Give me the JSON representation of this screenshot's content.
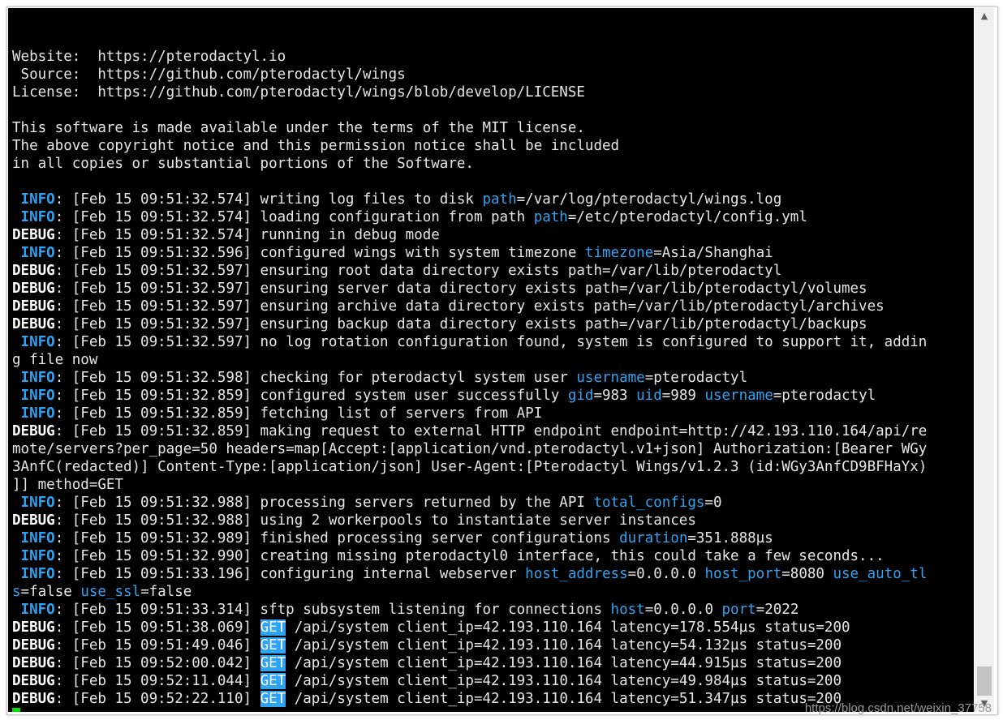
{
  "terminal": {
    "lines": [
      {
        "segments": []
      },
      {
        "segments": [
          {
            "text": "Website:  https://pterodactyl.io",
            "cls": ""
          }
        ]
      },
      {
        "segments": [
          {
            "text": " Source:  https://github.com/pterodactyl/wings",
            "cls": ""
          }
        ]
      },
      {
        "segments": [
          {
            "text": "License:  https://github.com/pterodactyl/wings/blob/develop/LICENSE",
            "cls": ""
          }
        ]
      },
      {
        "segments": []
      },
      {
        "segments": [
          {
            "text": "This software is made available under the terms of the MIT license.",
            "cls": ""
          }
        ]
      },
      {
        "segments": [
          {
            "text": "The above copyright notice and this permission notice shall be included",
            "cls": ""
          }
        ]
      },
      {
        "segments": [
          {
            "text": "in all copies or substantial portions of the Software.",
            "cls": ""
          }
        ]
      },
      {
        "segments": []
      },
      {
        "segments": [
          {
            "text": " INFO",
            "cls": "info"
          },
          {
            "text": ": [Feb 15 09:51:32.574] writing log files to disk ",
            "cls": ""
          },
          {
            "text": "path",
            "cls": "key"
          },
          {
            "text": "=/var/log/pterodactyl/wings.log",
            "cls": ""
          }
        ]
      },
      {
        "segments": [
          {
            "text": " INFO",
            "cls": "info"
          },
          {
            "text": ": [Feb 15 09:51:32.574] loading configuration from path ",
            "cls": ""
          },
          {
            "text": "path",
            "cls": "key"
          },
          {
            "text": "=/etc/pterodactyl/config.yml",
            "cls": ""
          }
        ]
      },
      {
        "segments": [
          {
            "text": "DEBUG",
            "cls": "debug"
          },
          {
            "text": ": [Feb 15 09:51:32.574] running in debug mode",
            "cls": ""
          }
        ]
      },
      {
        "segments": [
          {
            "text": " INFO",
            "cls": "info"
          },
          {
            "text": ": [Feb 15 09:51:32.596] configured wings with system timezone ",
            "cls": ""
          },
          {
            "text": "timezone",
            "cls": "key"
          },
          {
            "text": "=Asia/Shanghai",
            "cls": ""
          }
        ]
      },
      {
        "segments": [
          {
            "text": "DEBUG",
            "cls": "debug"
          },
          {
            "text": ": [Feb 15 09:51:32.597] ensuring root data directory exists path=/var/lib/pterodactyl",
            "cls": ""
          }
        ]
      },
      {
        "segments": [
          {
            "text": "DEBUG",
            "cls": "debug"
          },
          {
            "text": ": [Feb 15 09:51:32.597] ensuring server data directory exists path=/var/lib/pterodactyl/volumes",
            "cls": ""
          }
        ]
      },
      {
        "segments": [
          {
            "text": "DEBUG",
            "cls": "debug"
          },
          {
            "text": ": [Feb 15 09:51:32.597] ensuring archive data directory exists path=/var/lib/pterodactyl/archives",
            "cls": ""
          }
        ]
      },
      {
        "segments": [
          {
            "text": "DEBUG",
            "cls": "debug"
          },
          {
            "text": ": [Feb 15 09:51:32.597] ensuring backup data directory exists path=/var/lib/pterodactyl/backups",
            "cls": ""
          }
        ]
      },
      {
        "segments": [
          {
            "text": " INFO",
            "cls": "info"
          },
          {
            "text": ": [Feb 15 09:51:32.597] no log rotation configuration found, system is configured to support it, addin",
            "cls": ""
          }
        ]
      },
      {
        "segments": [
          {
            "text": "g file now",
            "cls": ""
          }
        ]
      },
      {
        "segments": [
          {
            "text": " INFO",
            "cls": "info"
          },
          {
            "text": ": [Feb 15 09:51:32.598] checking for pterodactyl system user ",
            "cls": ""
          },
          {
            "text": "username",
            "cls": "key"
          },
          {
            "text": "=pterodactyl",
            "cls": ""
          }
        ]
      },
      {
        "segments": [
          {
            "text": " INFO",
            "cls": "info"
          },
          {
            "text": ": [Feb 15 09:51:32.859] configured system user successfully ",
            "cls": ""
          },
          {
            "text": "gid",
            "cls": "key"
          },
          {
            "text": "=983 ",
            "cls": ""
          },
          {
            "text": "uid",
            "cls": "key"
          },
          {
            "text": "=989 ",
            "cls": ""
          },
          {
            "text": "username",
            "cls": "key"
          },
          {
            "text": "=pterodactyl",
            "cls": ""
          }
        ]
      },
      {
        "segments": [
          {
            "text": " INFO",
            "cls": "info"
          },
          {
            "text": ": [Feb 15 09:51:32.859] fetching list of servers from API",
            "cls": ""
          }
        ]
      },
      {
        "segments": [
          {
            "text": "DEBUG",
            "cls": "debug"
          },
          {
            "text": ": [Feb 15 09:51:32.859] making request to external HTTP endpoint endpoint=http://42.193.110.164/api/re",
            "cls": ""
          }
        ]
      },
      {
        "segments": [
          {
            "text": "mote/servers?per_page=50 headers=map[Accept:[application/vnd.pterodactyl.v1+json] Authorization:[Bearer WGy",
            "cls": ""
          }
        ]
      },
      {
        "segments": [
          {
            "text": "3AnfC(redacted)] Content-Type:[application/json] User-Agent:[Pterodactyl Wings/v1.2.3 (id:WGy3AnfCD9BFHaYx)",
            "cls": ""
          }
        ]
      },
      {
        "segments": [
          {
            "text": "]] method=GET",
            "cls": ""
          }
        ]
      },
      {
        "segments": [
          {
            "text": " INFO",
            "cls": "info"
          },
          {
            "text": ": [Feb 15 09:51:32.988] processing servers returned by the API ",
            "cls": ""
          },
          {
            "text": "total_configs",
            "cls": "key"
          },
          {
            "text": "=0",
            "cls": ""
          }
        ]
      },
      {
        "segments": [
          {
            "text": "DEBUG",
            "cls": "debug"
          },
          {
            "text": ": [Feb 15 09:51:32.988] using 2 workerpools to instantiate server instances",
            "cls": ""
          }
        ]
      },
      {
        "segments": [
          {
            "text": " INFO",
            "cls": "info"
          },
          {
            "text": ": [Feb 15 09:51:32.989] finished processing server configurations ",
            "cls": ""
          },
          {
            "text": "duration",
            "cls": "key"
          },
          {
            "text": "=351.888µs",
            "cls": ""
          }
        ]
      },
      {
        "segments": [
          {
            "text": " INFO",
            "cls": "info"
          },
          {
            "text": ": [Feb 15 09:51:32.990] creating missing pterodactyl0 interface, this could take a few seconds...",
            "cls": ""
          }
        ]
      },
      {
        "segments": [
          {
            "text": " INFO",
            "cls": "info"
          },
          {
            "text": ": [Feb 15 09:51:33.196] configuring internal webserver ",
            "cls": ""
          },
          {
            "text": "host_address",
            "cls": "key"
          },
          {
            "text": "=0.0.0.0 ",
            "cls": ""
          },
          {
            "text": "host_port",
            "cls": "key"
          },
          {
            "text": "=8080 ",
            "cls": ""
          },
          {
            "text": "use_auto_tl",
            "cls": "key"
          }
        ]
      },
      {
        "segments": [
          {
            "text": "s",
            "cls": "key"
          },
          {
            "text": "=false ",
            "cls": ""
          },
          {
            "text": "use_ssl",
            "cls": "key"
          },
          {
            "text": "=false",
            "cls": ""
          }
        ]
      },
      {
        "segments": [
          {
            "text": " INFO",
            "cls": "info"
          },
          {
            "text": ": [Feb 15 09:51:33.314] sftp subsystem listening for connections ",
            "cls": ""
          },
          {
            "text": "host",
            "cls": "key"
          },
          {
            "text": "=0.0.0.0 ",
            "cls": ""
          },
          {
            "text": "port",
            "cls": "key"
          },
          {
            "text": "=2022",
            "cls": ""
          }
        ]
      },
      {
        "segments": [
          {
            "text": "DEBUG",
            "cls": "debug"
          },
          {
            "text": ": [Feb 15 09:51:38.069] ",
            "cls": ""
          },
          {
            "text": "GET",
            "cls": "get"
          },
          {
            "text": " /api/system client_ip=42.193.110.164 latency=178.554µs status=200",
            "cls": ""
          }
        ]
      },
      {
        "segments": [
          {
            "text": "DEBUG",
            "cls": "debug"
          },
          {
            "text": ": [Feb 15 09:51:49.046] ",
            "cls": ""
          },
          {
            "text": "GET",
            "cls": "get"
          },
          {
            "text": " /api/system client_ip=42.193.110.164 latency=54.132µs status=200",
            "cls": ""
          }
        ]
      },
      {
        "segments": [
          {
            "text": "DEBUG",
            "cls": "debug"
          },
          {
            "text": ": [Feb 15 09:52:00.042] ",
            "cls": ""
          },
          {
            "text": "GET",
            "cls": "get"
          },
          {
            "text": " /api/system client_ip=42.193.110.164 latency=44.915µs status=200",
            "cls": ""
          }
        ]
      },
      {
        "segments": [
          {
            "text": "DEBUG",
            "cls": "debug"
          },
          {
            "text": ": [Feb 15 09:52:11.044] ",
            "cls": ""
          },
          {
            "text": "GET",
            "cls": "get"
          },
          {
            "text": " /api/system client_ip=42.193.110.164 latency=49.984µs status=200",
            "cls": ""
          }
        ]
      },
      {
        "segments": [
          {
            "text": "DEBUG",
            "cls": "debug"
          },
          {
            "text": ": [Feb 15 09:52:22.110] ",
            "cls": ""
          },
          {
            "text": "GET",
            "cls": "get"
          },
          {
            "text": " /api/system client_ip=42.193.110.164 latency=51.347µs status=200",
            "cls": ""
          }
        ]
      }
    ],
    "cursor_color": "#00e000",
    "key_color": "#2ea3f2"
  },
  "scrollbar": {
    "up_icon": "scroll-up-arrow-icon",
    "down_icon": "scroll-down-arrow-icon",
    "up_glyph": "▲",
    "down_glyph": "▼"
  },
  "watermark": {
    "text": "https://blog.csdn.net/weixin_37758"
  }
}
